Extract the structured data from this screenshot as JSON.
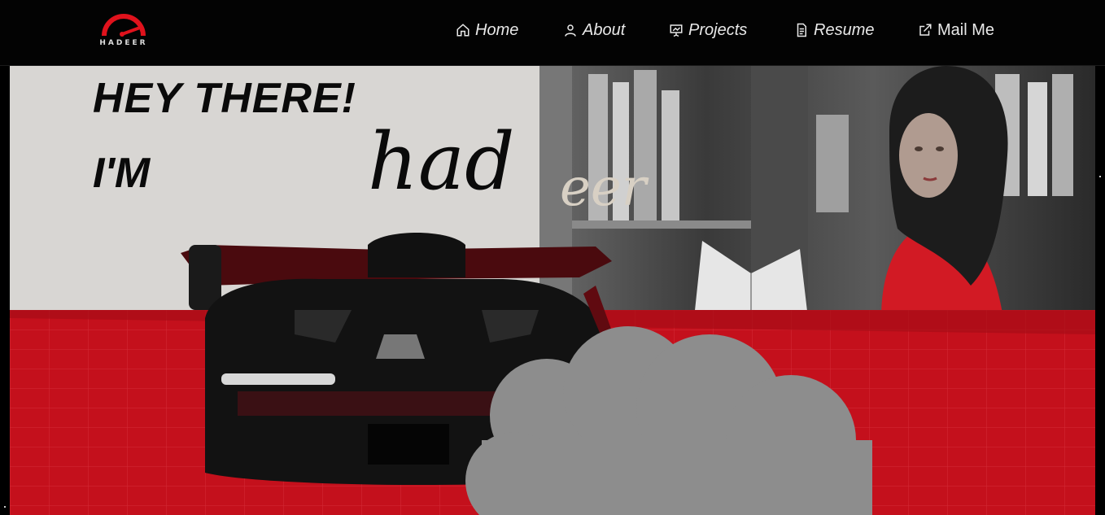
{
  "logo": {
    "text": "HADEER",
    "accent_color": "#e0121c"
  },
  "nav": {
    "items": [
      {
        "label": "Home",
        "icon": "home-icon"
      },
      {
        "label": "About",
        "icon": "user-icon"
      },
      {
        "label": "Projects",
        "icon": "presentation-icon"
      },
      {
        "label": "Resume",
        "icon": "document-icon"
      },
      {
        "label": "Mail Me",
        "icon": "external-link-icon"
      }
    ]
  },
  "hero": {
    "greeting": "HEY THERE!",
    "intro": "I'M",
    "name_part1": "had",
    "name_part2": "eer",
    "floor_color": "#c4101c"
  }
}
